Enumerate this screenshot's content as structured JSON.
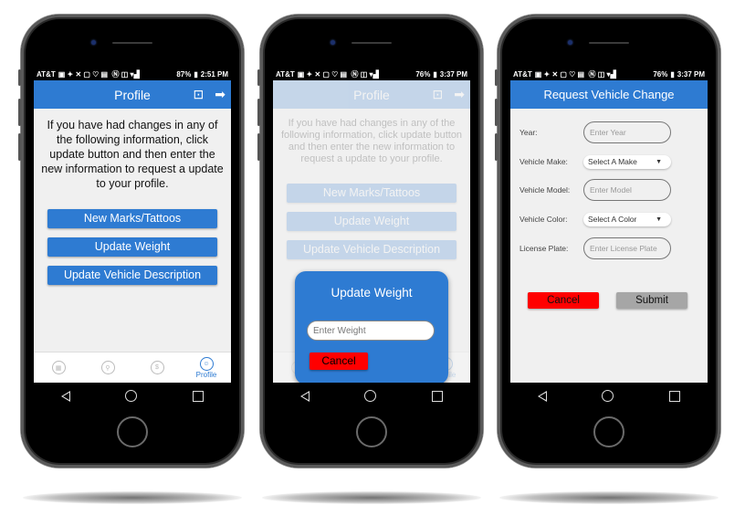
{
  "phones": [
    {
      "status": {
        "carrier": "AT&T",
        "battery": "87%",
        "time": "2:51 PM"
      },
      "appbar": {
        "title": "Profile",
        "feedback_icon": "feedback-icon",
        "logout_icon": "logout-icon"
      },
      "intro": "If you have had changes in any of the following information, click update button and then enter the new information to request a update to your profile.",
      "buttons": [
        "New Marks/Tattoos",
        "Update Weight",
        "Update Vehicle Description"
      ],
      "nav": [
        {
          "icon": "calendar-icon",
          "label": ""
        },
        {
          "icon": "location-pin-icon",
          "label": ""
        },
        {
          "icon": "badge-icon",
          "label": ""
        },
        {
          "icon": "profile-icon",
          "label": "Profile",
          "active": true
        }
      ]
    },
    {
      "status": {
        "carrier": "AT&T",
        "battery": "76%",
        "time": "3:37 PM"
      },
      "appbar": {
        "title": "Profile"
      },
      "intro": "If you have had changes in any of the following information, click update button and then enter the new information to request a update to your profile.",
      "buttons": [
        "New Marks/Tattoos",
        "Update Weight",
        "Update Vehicle Description"
      ],
      "nav": [
        {
          "icon": "calendar-icon",
          "label": ""
        },
        {
          "icon": "location-pin-icon",
          "label": ""
        },
        {
          "icon": "badge-icon",
          "label": ""
        },
        {
          "icon": "profile-icon",
          "label": "Profile",
          "active": true
        }
      ],
      "dialog": {
        "title": "Update Weight",
        "input_placeholder": "Enter Weight",
        "cancel_label": "Cancel"
      }
    },
    {
      "status": {
        "carrier": "AT&T",
        "battery": "76%",
        "time": "3:37 PM"
      },
      "appbar": {
        "title": "Request Vehicle Change"
      },
      "form": {
        "year": {
          "label": "Year:",
          "placeholder": "Enter Year"
        },
        "make": {
          "label": "Vehicle Make:",
          "value": "Select A Make"
        },
        "model": {
          "label": "Vehicle Model:",
          "placeholder": "Enter Model"
        },
        "color": {
          "label": "Vehicle Color:",
          "value": "Select A Color"
        },
        "plate": {
          "label": "License Plate:",
          "placeholder": "Enter License Plate"
        }
      },
      "cancel_label": "Cancel",
      "submit_label": "Submit"
    }
  ],
  "colors": {
    "primary": "#2e7bd2",
    "cancel": "#ff0000",
    "submit": "#a6a6a6",
    "screen_bg": "#f0f0f0"
  }
}
